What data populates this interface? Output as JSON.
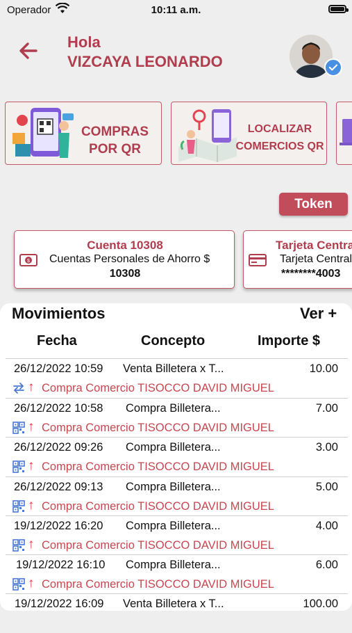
{
  "status": {
    "carrier": "Operador",
    "time": "10:11 a.m."
  },
  "header": {
    "greeting": "Hola",
    "name": "VIZCAYA LEONARDO"
  },
  "quick_actions": [
    {
      "label1": "COMPRAS",
      "label2": "POR QR"
    },
    {
      "label1": "LOCALIZAR",
      "label2": "COMERCIOS QR"
    }
  ],
  "token_label": "Token",
  "accounts": [
    {
      "title": "Cuenta 10308",
      "subtitle": "Cuentas Personales de Ahorro $",
      "number": "10308"
    },
    {
      "title": "Tarjeta Central",
      "subtitle": "Tarjeta Central",
      "number": "********4003"
    }
  ],
  "movements": {
    "title": "Movimientos",
    "more": "Ver +",
    "headers": {
      "date": "Fecha",
      "concept": "Concepto",
      "amount": "Importe $"
    },
    "rows": [
      {
        "date": "26/12/2022 10:59",
        "concept": "Venta Billetera x T...",
        "amount": "10.00",
        "desc": "Compra Comercio TISOCCO DAVID MIGUEL",
        "icon": "transfer-icon"
      },
      {
        "date": "26/12/2022 10:58",
        "concept": "Compra Billetera...",
        "amount": "7.00",
        "desc": "Compra Comercio TISOCCO DAVID MIGUEL",
        "icon": "qr-icon"
      },
      {
        "date": "26/12/2022 09:26",
        "concept": "Compra Billetera...",
        "amount": "3.00",
        "desc": "Compra Comercio TISOCCO DAVID MIGUEL",
        "icon": "qr-icon"
      },
      {
        "date": "26/12/2022 09:13",
        "concept": "Compra Billetera...",
        "amount": "5.00",
        "desc": "Compra Comercio TISOCCO DAVID MIGUEL",
        "icon": "qr-icon"
      },
      {
        "date": "19/12/2022 16:20",
        "concept": "Compra Billetera...",
        "amount": "4.00",
        "desc": "Compra Comercio TISOCCO DAVID MIGUEL",
        "icon": "qr-icon"
      },
      {
        "date": "19/12/2022 16:10",
        "concept": "Compra Billetera...",
        "amount": "6.00",
        "desc": "Compra Comercio TISOCCO DAVID MIGUEL",
        "icon": "qr-icon"
      },
      {
        "date": "19/12/2022 16:09",
        "concept": "Venta Billetera x T...",
        "amount": "100.00",
        "desc": "",
        "icon": "transfer-icon"
      }
    ]
  },
  "colors": {
    "brand": "#b03d4e",
    "button": "#c24d5a",
    "negative": "#e0303f",
    "icon_blue": "#4a78d6"
  }
}
